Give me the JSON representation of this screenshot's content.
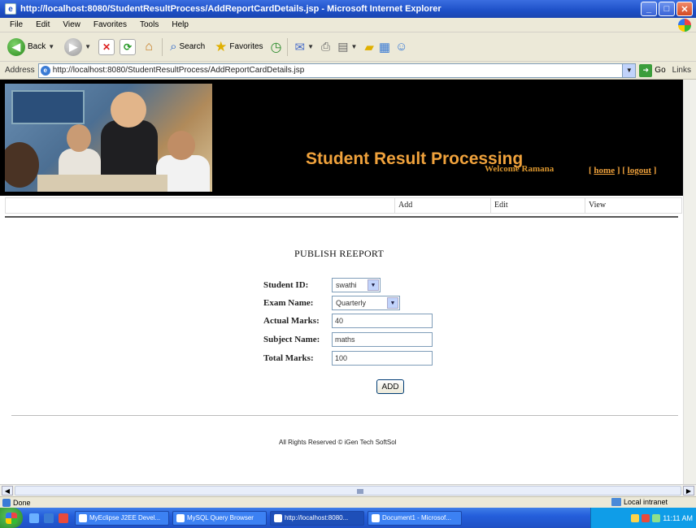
{
  "window": {
    "title": "http://localhost:8080/StudentResultProcess/AddReportCardDetails.jsp - Microsoft Internet Explorer"
  },
  "menu": [
    "File",
    "Edit",
    "View",
    "Favorites",
    "Tools",
    "Help"
  ],
  "toolbar": {
    "back_label": "Back",
    "search_label": "Search",
    "favorites_label": "Favorites"
  },
  "address": {
    "label": "Address",
    "url": "http://localhost:8080/StudentResultProcess/AddReportCardDetails.jsp",
    "go_label": "Go",
    "links_label": "Links"
  },
  "banner": {
    "site_title": "Student Result Processing",
    "welcome": "Welcome Ramana",
    "home_link": "home",
    "logout_link": "logout"
  },
  "subnav": {
    "add": "Add",
    "edit": "Edit",
    "view": "View"
  },
  "form": {
    "heading": "PUBLISH REEPORT",
    "student_id_label": "Student ID:",
    "student_id_value": "swathi",
    "exam_name_label": "Exam Name:",
    "exam_name_value": "Quarterly",
    "actual_marks_label": "Actual Marks:",
    "actual_marks_value": "40",
    "subject_name_label": "Subject Name:",
    "subject_name_value": "maths",
    "total_marks_label": "Total Marks:",
    "total_marks_value": "100",
    "add_button": "ADD"
  },
  "footer": {
    "text": "All Rights Reserved © iGen Tech SoftSol"
  },
  "status": {
    "text": "Done",
    "zone": "Local intranet"
  },
  "taskbar": {
    "tasks": [
      "MyEclipse J2EE Devel...",
      "MySQL Query Browser",
      "http://localhost:8080...",
      "Document1 - Microsof..."
    ],
    "clock": "11:11 AM"
  },
  "colors": {
    "title_orange": "#f0a23c",
    "banner_bg": "#000000",
    "xp_blue": "#245edb"
  }
}
